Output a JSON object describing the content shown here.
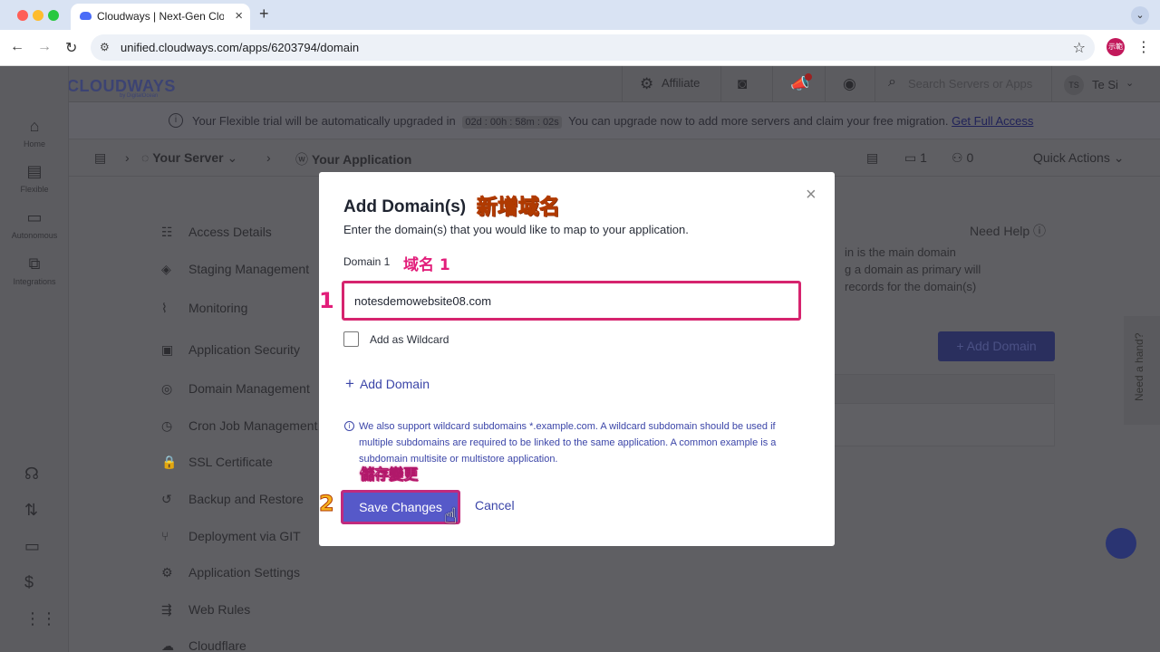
{
  "browser": {
    "tab_title": "Cloudways | Next-Gen Cloud",
    "tab_close": "×",
    "new_tab": "+",
    "url": "unified.cloudways.com/apps/6203794/domain",
    "profile_initials": "示範"
  },
  "app": {
    "logo_text": "CLOUDWAYS",
    "logo_sub": "by DigitalOcean",
    "topbar": {
      "affiliate": "Affiliate",
      "search_placeholder": "Search Servers or Apps",
      "user_initials": "TS",
      "user_name": "Te Si"
    },
    "sidebar": [
      {
        "label": "Home",
        "icon": "home-icon"
      },
      {
        "label": "Flexible",
        "icon": "flexible-icon"
      },
      {
        "label": "Autonomous",
        "icon": "autonomous-icon"
      },
      {
        "label": "Integrations",
        "icon": "integrations-icon"
      }
    ],
    "banner": {
      "pre": "Your Flexible trial will be automatically upgraded in",
      "timer": "02d : 00h : 58m : 02s",
      "post": "You can upgrade now to add more servers and claim your free migration.",
      "link": "Get Full Access"
    },
    "breadcrumb": {
      "server": "Your Server",
      "application": "Your Application",
      "folder_count": "1",
      "user_count": "0",
      "quick_actions": "Quick Actions"
    },
    "menu": [
      {
        "label": "Access Details",
        "icon": "access-icon"
      },
      {
        "label": "Staging Management",
        "icon": "staging-icon"
      },
      {
        "label": "Monitoring",
        "icon": "monitoring-icon"
      },
      {
        "label": "Application Security",
        "icon": "security-icon"
      },
      {
        "label": "Domain Management",
        "icon": "globe-icon"
      },
      {
        "label": "Cron Job Management",
        "icon": "cron-icon"
      },
      {
        "label": "SSL Certificate",
        "icon": "lock-icon"
      },
      {
        "label": "Backup and Restore",
        "icon": "backup-icon"
      },
      {
        "label": "Deployment via GIT",
        "icon": "git-icon"
      },
      {
        "label": "Application Settings",
        "icon": "settings-icon"
      },
      {
        "label": "Web Rules",
        "icon": "rules-icon"
      },
      {
        "label": "Cloudflare",
        "icon": "cloud-icon"
      }
    ],
    "right": {
      "need_help": "Need Help",
      "lines": [
        "in is the main domain",
        "g a domain as primary will",
        "records for the domain(s)"
      ],
      "add_domain_button": "+ Add Domain",
      "need_a_hand": "Need a hand?"
    }
  },
  "modal": {
    "title": "Add Domain(s)",
    "subtitle": "Enter the domain(s) that you would like to map to your application.",
    "domain_label": "Domain 1",
    "domain_value": "notesdemowebsite08.com",
    "wildcard_label": "Add as Wildcard",
    "add_domain": "Add Domain",
    "info": "We also support wildcard subdomains *.example.com. A wildcard subdomain should be used if multiple subdomains are required to be linked to the same application. A common example is a subdomain multisite or multistore application.",
    "save": "Save Changes",
    "cancel": "Cancel",
    "close": "×"
  },
  "annotations": {
    "title_zh": "新增域名",
    "domain_zh": "域名 1",
    "save_zh": "儲存變更",
    "step1": "1",
    "step2": "2"
  },
  "colors": {
    "accent": "#3b45a8",
    "highlight_pink": "#d6246e",
    "save_button": "#5659c9",
    "annotation_orange": "#f7b21c"
  }
}
